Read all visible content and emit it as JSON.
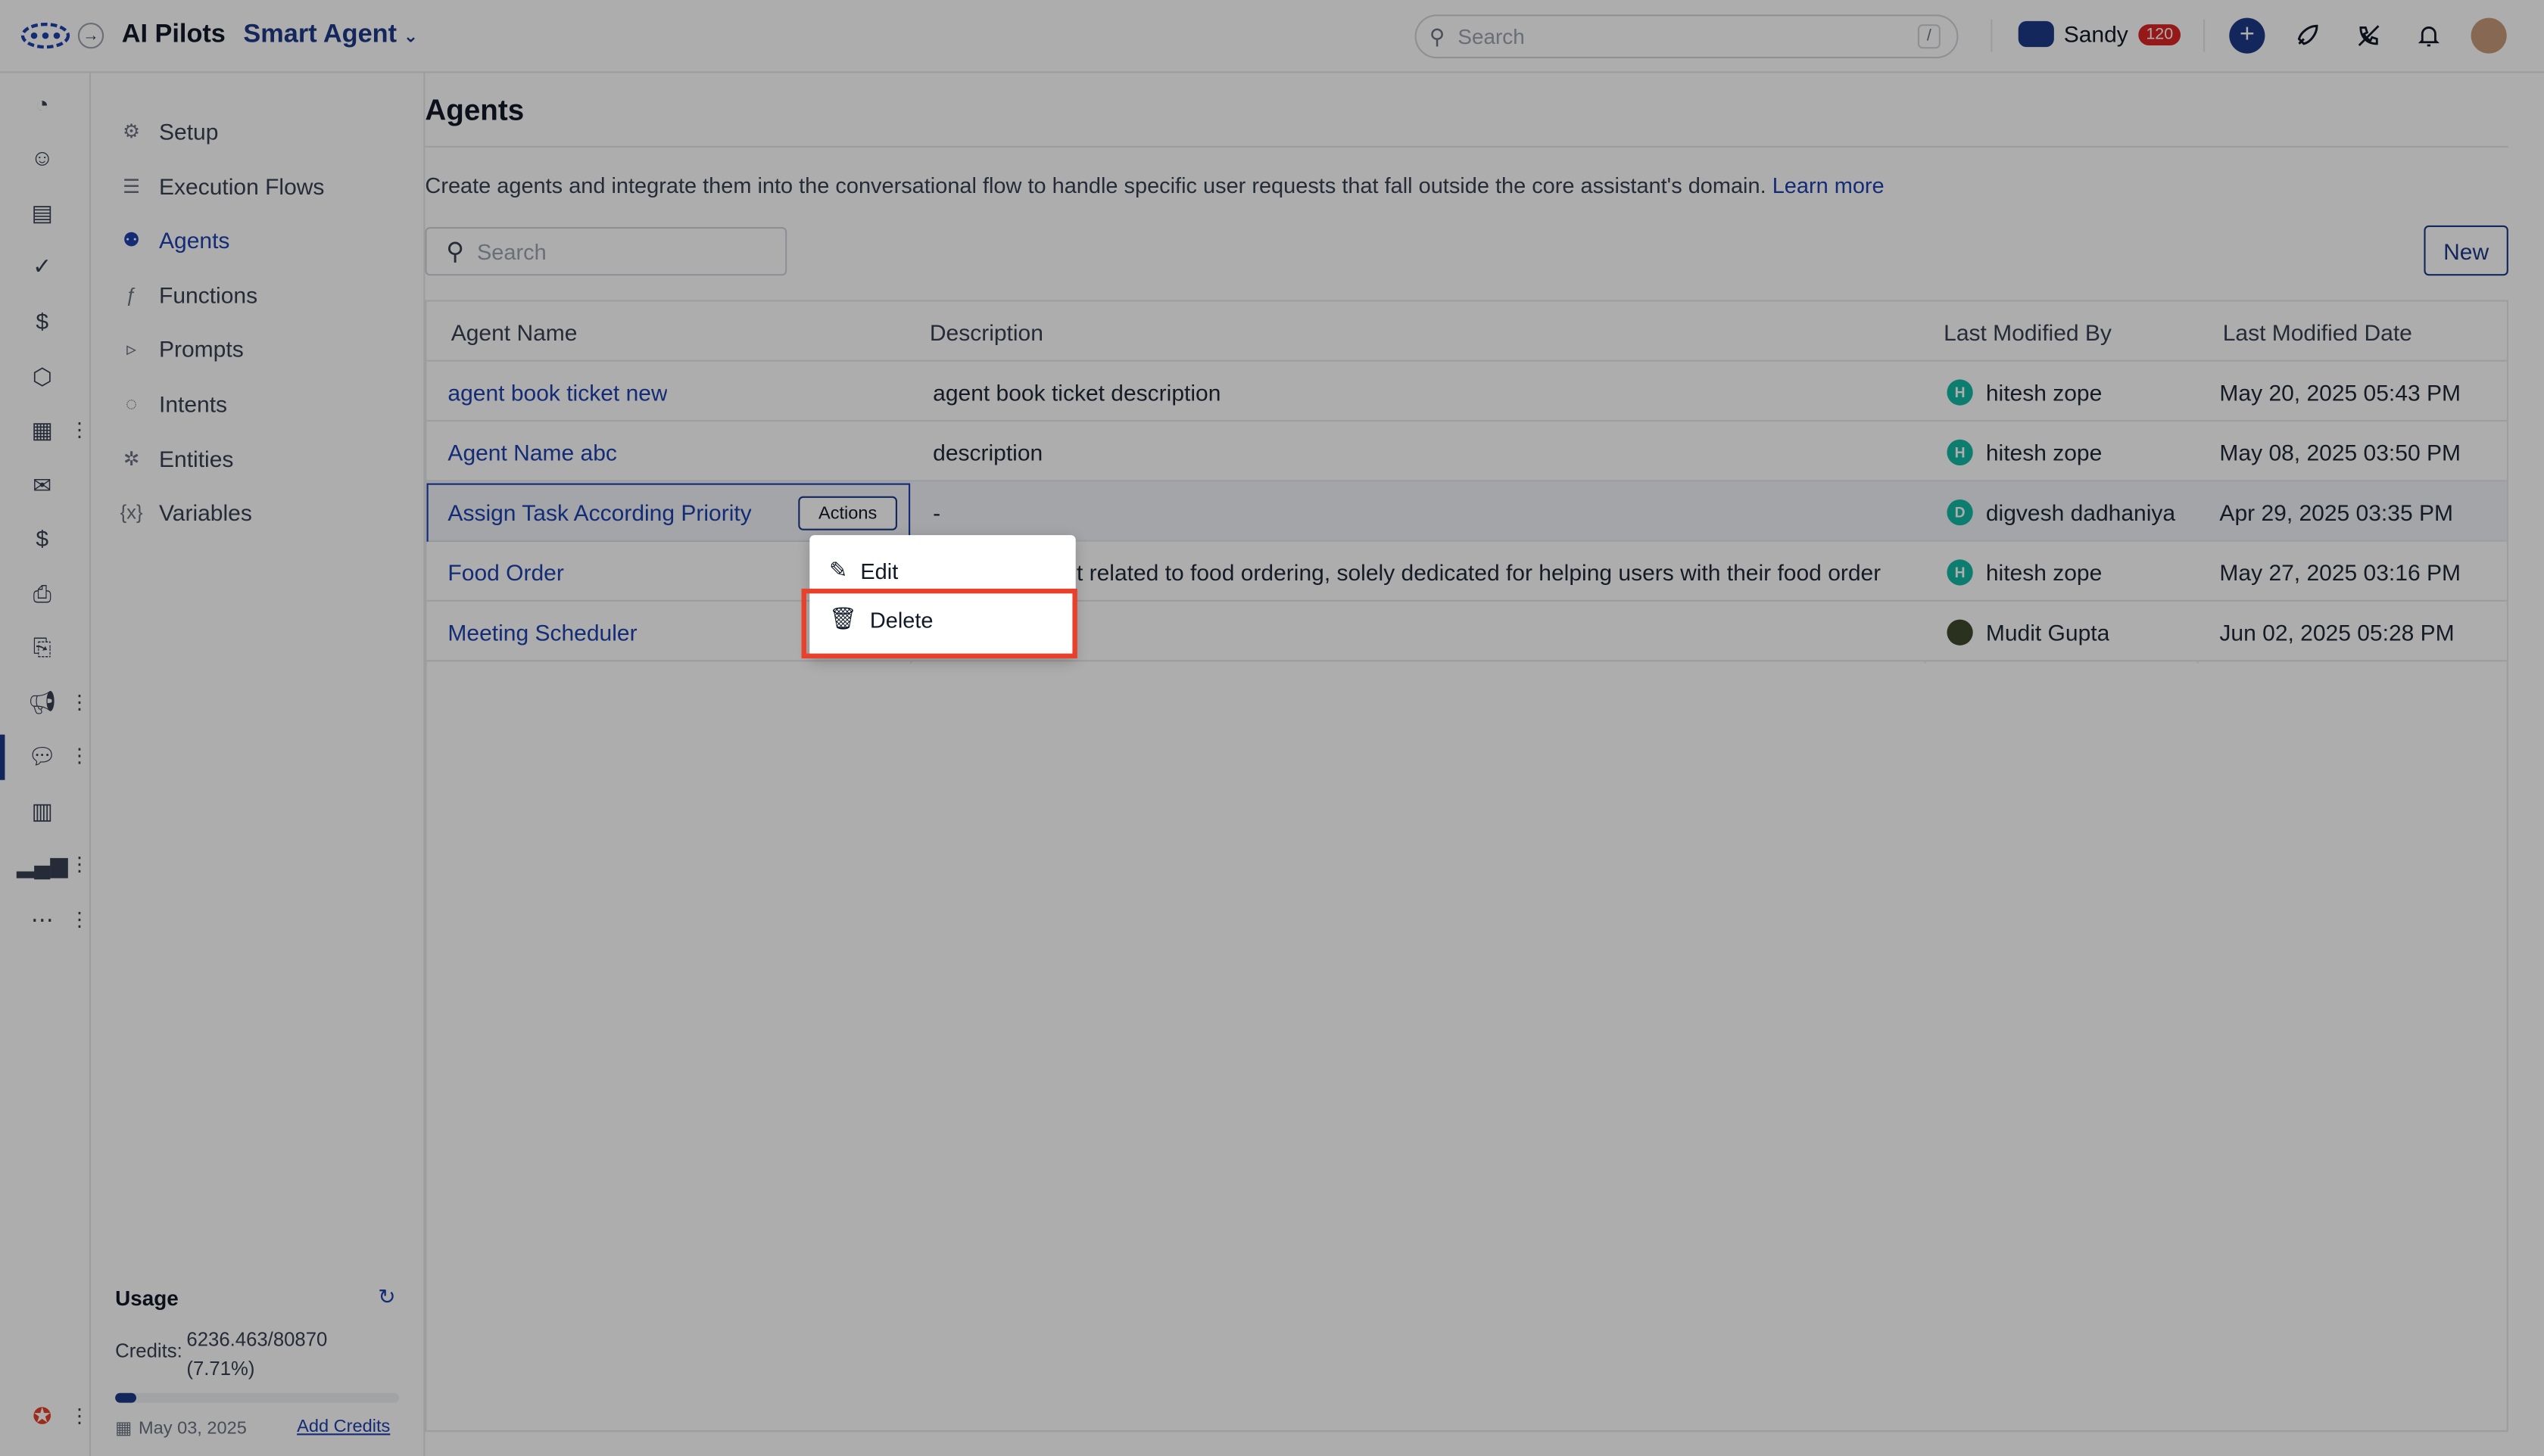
{
  "header": {
    "app_title": "AI Pilots",
    "app_switcher": "Smart Agent",
    "search_placeholder": "Search",
    "search_shortcut": "/",
    "user_name": "Sandy",
    "user_badge": "120"
  },
  "rail": {
    "icons": [
      "dashboard-icon",
      "contacts-icon",
      "accounts-icon",
      "tasks-icon",
      "deals-icon",
      "products-icon",
      "apps-icon",
      "mail-icon",
      "billing-icon",
      "inbox-icon",
      "docs-icon",
      "campaigns-icon",
      "chat-icon",
      "reports-icon",
      "analytics-icon",
      "more-icon",
      "support-icon"
    ]
  },
  "subnav": {
    "items": [
      {
        "label": "Setup",
        "icon": "gear-icon"
      },
      {
        "label": "Execution Flows",
        "icon": "flow-icon"
      },
      {
        "label": "Agents",
        "icon": "robot-icon"
      },
      {
        "label": "Functions",
        "icon": "function-icon"
      },
      {
        "label": "Prompts",
        "icon": "prompt-icon"
      },
      {
        "label": "Intents",
        "icon": "intent-icon"
      },
      {
        "label": "Entities",
        "icon": "entity-icon"
      },
      {
        "label": "Variables",
        "icon": "variable-icon"
      }
    ],
    "usage": {
      "title": "Usage",
      "credits_label": "Credits:",
      "credits_value": "6236.463/80870 (7.71%)",
      "progress_fraction": 0.0771,
      "date": "May 03, 2025",
      "add_credits": "Add Credits"
    }
  },
  "main": {
    "title": "Agents",
    "description": "Create agents and integrate them into the conversational flow to handle specific user requests that fall outside the core assistant's domain.",
    "learn_more": "Learn more",
    "search_placeholder": "Search",
    "new_button": "New",
    "table": {
      "headers": [
        "Agent Name",
        "Description",
        "Last Modified By",
        "Last Modified Date"
      ],
      "rows": [
        {
          "name": "agent book ticket new",
          "description": "agent book ticket description",
          "avatar": "H",
          "modified_by": "hitesh zope",
          "modified_date": "May 20, 2025 05:43 PM"
        },
        {
          "name": "Agent Name abc",
          "description": "description",
          "avatar": "H",
          "modified_by": "hitesh zope",
          "modified_date": "May 08, 2025 03:50 PM"
        },
        {
          "name": "Assign Task According Priority",
          "description": "-",
          "avatar": "D",
          "modified_by": "digvesh dadhaniya",
          "modified_date": "Apr 29, 2025 03:35 PM"
        },
        {
          "name": "Food Order",
          "description": "ent related to food ordering, solely dedicated for helping users with their food order",
          "avatar": "H",
          "modified_by": "hitesh zope",
          "modified_date": "May 27, 2025 03:16 PM"
        },
        {
          "name": "Meeting Scheduler",
          "description": "",
          "avatar": "",
          "modified_by": "Mudit Gupta",
          "modified_date": "Jun 02, 2025 05:28 PM"
        }
      ]
    },
    "row_actions_label": "Actions",
    "actions_menu": [
      "Edit",
      "Delete"
    ]
  },
  "colors": {
    "accent": "#1e3a8a",
    "link": "#1e40af",
    "highlight": "#e8402a",
    "avatar": "#14b8a6"
  }
}
